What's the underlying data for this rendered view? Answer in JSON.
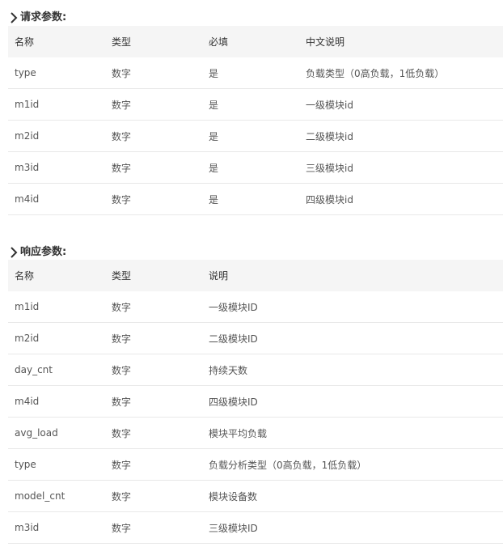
{
  "request": {
    "title": "请求参数:",
    "headers": [
      "名称",
      "类型",
      "必填",
      "中文说明"
    ],
    "rows": [
      [
        "type",
        "数字",
        "是",
        "负载类型（0高负载，1低负载）"
      ],
      [
        "m1id",
        "数字",
        "是",
        "一级模块id"
      ],
      [
        "m2id",
        "数字",
        "是",
        "二级模块id"
      ],
      [
        "m3id",
        "数字",
        "是",
        "三级模块id"
      ],
      [
        "m4id",
        "数字",
        "是",
        "四级模块id"
      ]
    ]
  },
  "response": {
    "title": "响应参数:",
    "headers": [
      "名称",
      "类型",
      "说明"
    ],
    "rows": [
      [
        "m1id",
        "数字",
        "一级模块ID"
      ],
      [
        "m2id",
        "数字",
        "二级模块ID"
      ],
      [
        "day_cnt",
        "数字",
        "持续天数"
      ],
      [
        "m4id",
        "数字",
        "四级模块ID"
      ],
      [
        "avg_load",
        "数字",
        "模块平均负载"
      ],
      [
        "type",
        "数字",
        "负载分析类型（0高负载，1低负载）"
      ],
      [
        "model_cnt",
        "数字",
        "模块设备数"
      ],
      [
        "m3id",
        "数字",
        "三级模块ID"
      ]
    ]
  }
}
